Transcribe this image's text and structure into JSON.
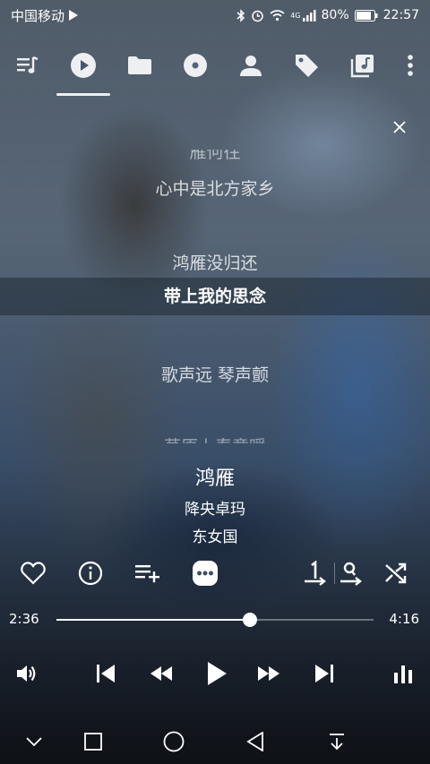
{
  "status_bar": {
    "carrier": "中国移动",
    "battery": "80%",
    "network": "4G",
    "time": "22:57"
  },
  "tabs": [
    {
      "icon": "queue-icon",
      "active": false
    },
    {
      "icon": "play-icon",
      "active": true
    },
    {
      "icon": "folder-icon",
      "active": false
    },
    {
      "icon": "album-icon",
      "active": false
    },
    {
      "icon": "artist-icon",
      "active": false
    },
    {
      "icon": "tag-icon",
      "active": false
    },
    {
      "icon": "library-icon",
      "active": false
    },
    {
      "icon": "more-vert-icon",
      "active": false
    }
  ],
  "lyrics": {
    "partial_top": "雁何往",
    "line1": "心中是北方家乡",
    "line2": "鸿雁没归还",
    "current": "带上我的思念",
    "line4": "歌声远 琴声颤",
    "partial_bottom": "草原上春意暖"
  },
  "now_playing": {
    "title": "鸿雁",
    "artist": "降央卓玛",
    "album": "东女国"
  },
  "progress": {
    "current_time": "2:36",
    "total_time": "4:16",
    "fraction": 0.609
  },
  "colors": {
    "accent": "#ffffff"
  }
}
